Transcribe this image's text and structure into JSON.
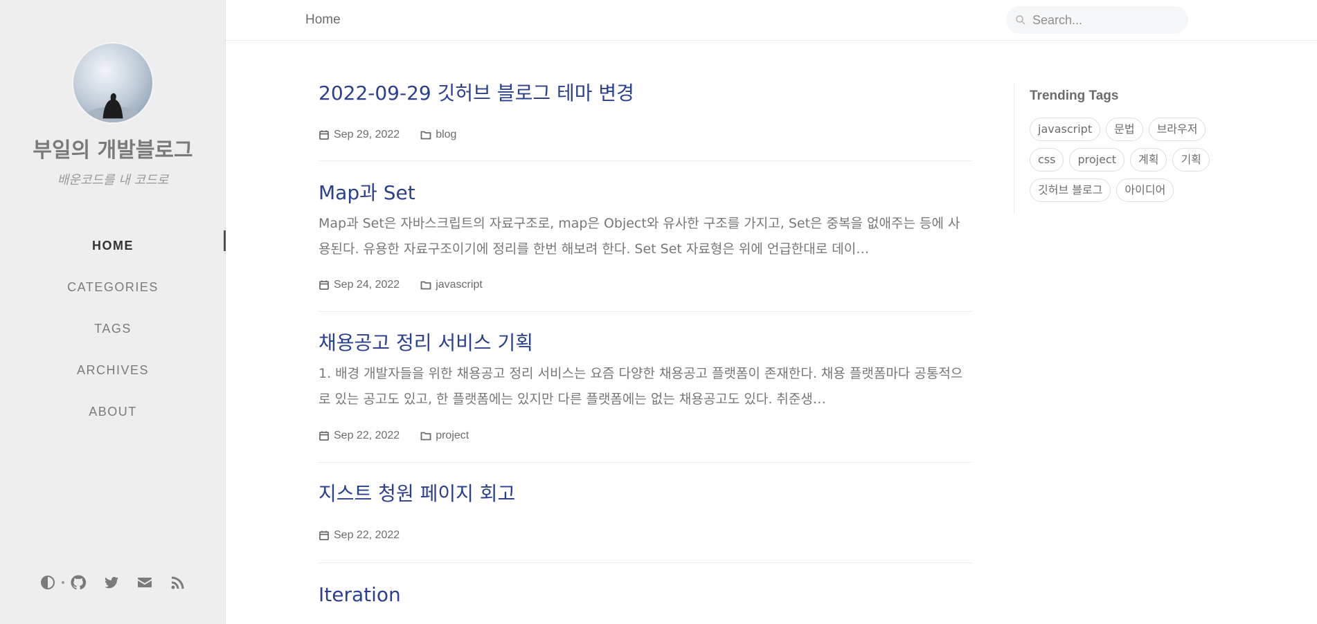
{
  "sidebar": {
    "site_title": "부일의 개발블로그",
    "site_subtitle": "배운코드를 내 코드로",
    "nav": [
      {
        "label": "HOME",
        "active": true
      },
      {
        "label": "CATEGORIES"
      },
      {
        "label": "TAGS"
      },
      {
        "label": "ARCHIVES"
      },
      {
        "label": "ABOUT"
      }
    ],
    "bottom_icons": [
      "theme-toggle-icon",
      "github-icon",
      "twitter-icon",
      "email-icon",
      "rss-icon"
    ]
  },
  "topbar": {
    "breadcrumb": "Home",
    "search_placeholder": "Search..."
  },
  "posts": [
    {
      "title": "2022-09-29 깃허브 블로그 테마 변경",
      "excerpt": "",
      "date": "Sep 29, 2022",
      "category": "blog"
    },
    {
      "title": "Map과 Set",
      "excerpt": "Map과 Set은 자바스크립트의 자료구조로, map은 Object와 유사한 구조를 가지고, Set은 중복을 없애주는 등에 사용된다. 유용한 자료구조이기에 정리를 한번 해보려 한다. Set Set 자료형은 위에 언급한대로 데이…",
      "date": "Sep 24, 2022",
      "category": "javascript"
    },
    {
      "title": "채용공고 정리 서비스 기획",
      "excerpt": "1. 배경 개발자들을 위한 채용공고 정리 서비스는 요즘 다양한 채용공고 플랫폼이 존재한다. 채용 플랫폼마다 공통적으로 있는 공고도 있고, 한 플랫폼에는 있지만 다른 플랫폼에는 없는 채용공고도 있다. 취준생…",
      "date": "Sep 22, 2022",
      "category": "project"
    },
    {
      "title": "지스트 청원 페이지 회고",
      "excerpt": "",
      "date": "Sep 22, 2022",
      "category": ""
    },
    {
      "title": "Iteration",
      "excerpt": "",
      "date": "",
      "category": ""
    }
  ],
  "trending": {
    "title": "Trending Tags",
    "tags": [
      "javascript",
      "문법",
      "브라우저",
      "css",
      "project",
      "계획",
      "기획",
      "깃허브 블로그",
      "아이디어"
    ]
  },
  "colors": {
    "sidebar_bg": "#eeeeee",
    "post_title": "#2a408e",
    "text": "#6c757d"
  }
}
